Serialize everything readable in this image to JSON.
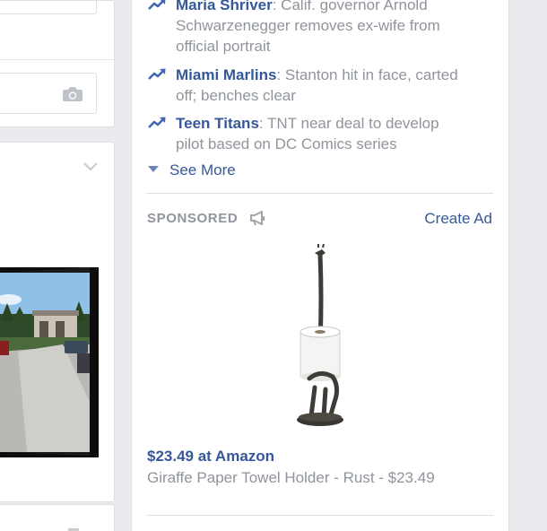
{
  "trending": [
    {
      "name": "Maria Shriver",
      "text": ": Calif. governor Arnold Schwarzenegger removes ex-wife from official portrait"
    },
    {
      "name": "Miami Marlins",
      "text": ": Stanton hit in face, carted off; benches clear"
    },
    {
      "name": "Teen Titans",
      "text": ": TNT near deal to develop pilot based on DC Comics series"
    }
  ],
  "see_more_label": "See More",
  "ads": {
    "sponsored_label": "SPONSORED",
    "create_ad_label": "Create Ad",
    "item": {
      "price_line": "$23.49 at Amazon",
      "description": "Giraffe Paper Towel Holder - Rust - $23.49"
    }
  },
  "icons": {
    "trending": "trending-arrow-icon",
    "camera": "camera-icon",
    "chevron": "chevron-down-icon",
    "megaphone": "megaphone-icon"
  },
  "colors": {
    "link": "#365899",
    "muted": "#90949c",
    "background": "#e9ebee",
    "trend_icon": "#4267b2"
  }
}
